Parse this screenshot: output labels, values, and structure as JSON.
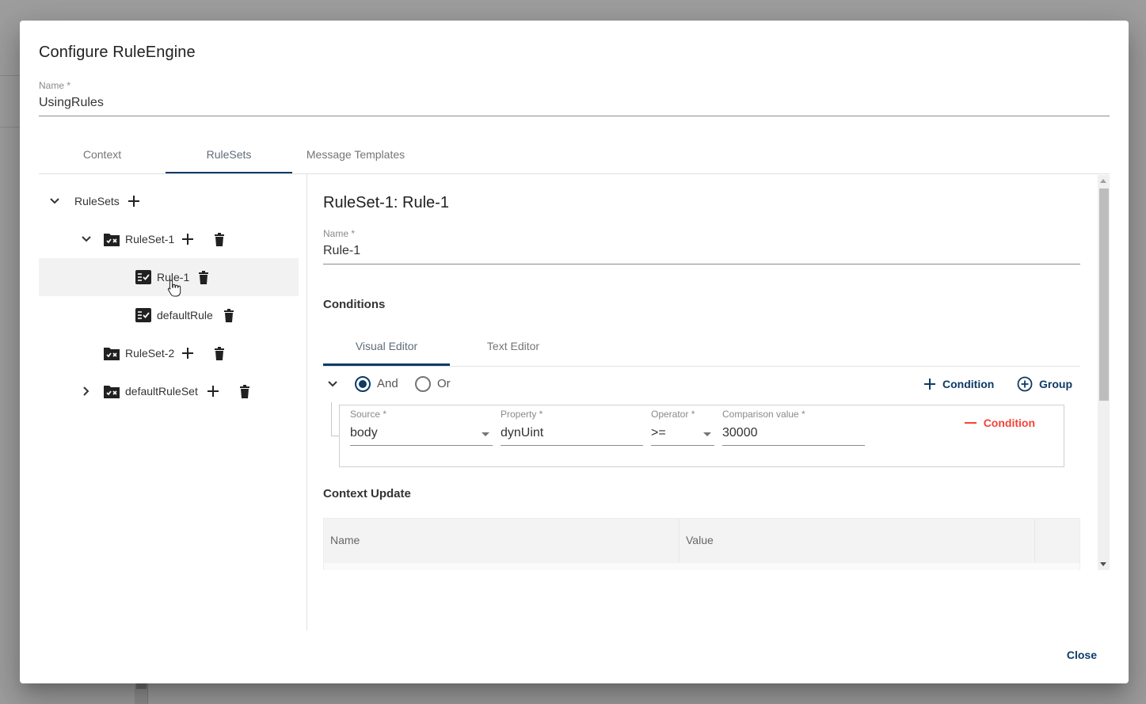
{
  "dialog": {
    "title": "Configure RuleEngine",
    "name_label": "Name *",
    "name_value": "UsingRules",
    "close_label": "Close"
  },
  "tabs": [
    {
      "label": "Context",
      "active": false
    },
    {
      "label": "RuleSets",
      "active": true
    },
    {
      "label": "Message Templates",
      "active": false
    }
  ],
  "tree": {
    "root": {
      "label": "RuleSets",
      "expanded": true
    },
    "items": [
      {
        "label": "RuleSet-1",
        "type": "ruleset",
        "expanded": true
      },
      {
        "label": "Rule-1",
        "type": "rule",
        "selected": true
      },
      {
        "label": "defaultRule",
        "type": "rule"
      },
      {
        "label": "RuleSet-2",
        "type": "ruleset"
      },
      {
        "label": "defaultRuleSet",
        "type": "ruleset",
        "expanded": false
      }
    ]
  },
  "editor": {
    "title": "RuleSet-1: Rule-1",
    "name_label": "Name *",
    "name_value": "Rule-1",
    "conditions_title": "Conditions",
    "subtabs": [
      {
        "label": "Visual Editor",
        "active": true
      },
      {
        "label": "Text Editor",
        "active": false
      }
    ],
    "group": {
      "and_label": "And",
      "or_label": "Or",
      "selected": "And",
      "add_condition_label": "Condition",
      "add_group_label": "Group"
    },
    "condition": {
      "source_label": "Source *",
      "source_value": "body",
      "property_label": "Property *",
      "property_value": "dynUint",
      "operator_label": "Operator *",
      "operator_value": ">=",
      "comparison_label": "Comparison value *",
      "comparison_value": "30000",
      "remove_label": "Condition"
    },
    "context_update_title": "Context Update",
    "context_table": {
      "columns": [
        "Name",
        "Value",
        ""
      ]
    }
  },
  "colors": {
    "primary": "#0d3b66",
    "danger": "#f44336",
    "selected_row": "#f2f2f2"
  }
}
